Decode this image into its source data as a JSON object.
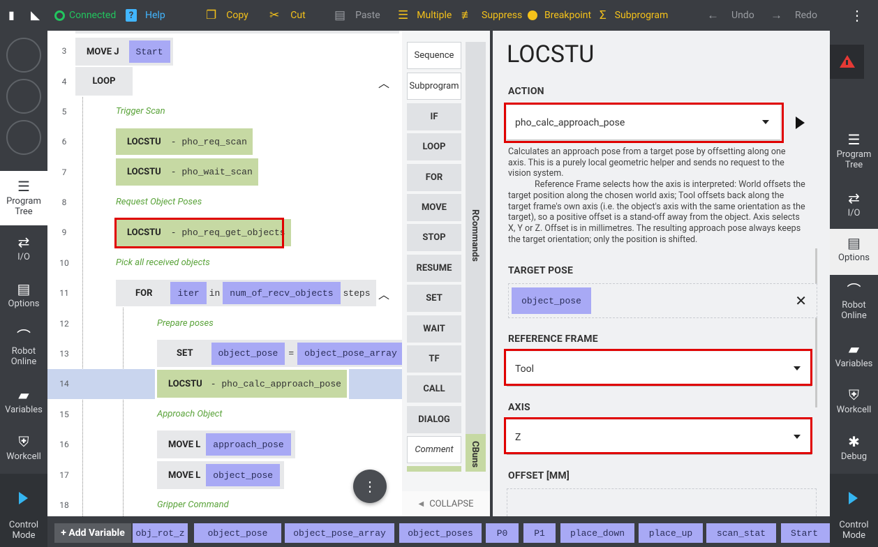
{
  "topbar": {
    "connected": "Connected",
    "help": "Help",
    "copy": "Copy",
    "cut": "Cut",
    "paste": "Paste",
    "multiple": "Multiple",
    "suppress": "Suppress",
    "breakpoint": "Breakpoint",
    "subprogram": "Subprogram",
    "undo": "Undo",
    "redo": "Redo"
  },
  "left_nav": {
    "items": [
      {
        "label": "Program Tree",
        "icon": "program-tree-icon"
      },
      {
        "label": "I/O",
        "icon": "io-icon"
      },
      {
        "label": "Options",
        "icon": "clipboard-icon"
      },
      {
        "label": "Robot Online",
        "icon": "robot-arm-icon"
      },
      {
        "label": "Variables",
        "icon": "briefcase-icon"
      },
      {
        "label": "Workcell",
        "icon": "shield-icon"
      }
    ],
    "control_mode": "Control Mode"
  },
  "right_nav": {
    "items": [
      {
        "label": "Program Tree",
        "icon": "program-tree-icon"
      },
      {
        "label": "I/O",
        "icon": "io-icon"
      },
      {
        "label": "Options",
        "icon": "clipboard-icon"
      },
      {
        "label": "Robot Online",
        "icon": "robot-arm-icon"
      },
      {
        "label": "Variables",
        "icon": "briefcase-icon"
      },
      {
        "label": "Workcell",
        "icon": "shield-icon"
      },
      {
        "label": "Debug",
        "icon": "bug-icon"
      }
    ],
    "control_mode": "Control Mode"
  },
  "program": {
    "lines": [
      {
        "n": "3",
        "cmd": "MOVE J",
        "var": "Start"
      },
      {
        "n": "4",
        "cmd": "LOOP"
      },
      {
        "n": "5",
        "comment": "Trigger Scan"
      },
      {
        "n": "6",
        "cmd": "LOCSTU",
        "arg": "- pho_req_scan"
      },
      {
        "n": "7",
        "cmd": "LOCSTU",
        "arg": "- pho_wait_scan"
      },
      {
        "n": "8",
        "comment": "Request Object Poses"
      },
      {
        "n": "9",
        "cmd": "LOCSTU",
        "arg": "- pho_req_get_objects"
      },
      {
        "n": "10",
        "comment": "Pick all received objects"
      },
      {
        "n": "11",
        "cmd": "FOR",
        "var1": "iter",
        "in": "in",
        "var2": "num_of_recv_objects",
        "steps": "steps"
      },
      {
        "n": "12",
        "comment": "Prepare poses"
      },
      {
        "n": "13",
        "cmd": "SET",
        "var1": "object_pose",
        "eq": "=",
        "var2": "object_pose_array",
        "tail": "["
      },
      {
        "n": "14",
        "cmd": "LOCSTU",
        "arg": "- pho_calc_approach_pose"
      },
      {
        "n": "15",
        "comment": "Approach Object"
      },
      {
        "n": "16",
        "cmd": "MOVE L",
        "var": "approach_pose"
      },
      {
        "n": "17",
        "cmd": "MOVE L",
        "var": "object_pose"
      },
      {
        "n": "18",
        "comment": "Gripper Command"
      }
    ]
  },
  "palette": {
    "buttons": [
      "Sequence",
      "Subprogram",
      "IF",
      "LOOP",
      "FOR",
      "MOVE",
      "STOP",
      "RESUME",
      "SET",
      "WAIT",
      "TF",
      "CALL",
      "DIALOG",
      "Comment"
    ],
    "tab_rcommands": "RCommands",
    "tab_cbuns": "CBuns",
    "collapse": "COLLAPSE"
  },
  "options": {
    "title": "LOCSTU",
    "action_label": "ACTION",
    "action_value": "pho_calc_approach_pose",
    "description_p1": "Calculates an approach pose from a target pose by offsetting along one axis. This is a purely local geometric helper and sends no request to the vision system.",
    "description_p2": "Reference Frame selects how the axis is interpreted: World offsets the target position along the chosen world axis; Tool offsets back along the target frame's own axis (i.e. the object's axis with the same orientation as the target), so a positive offset is a stand-off away from the object. Axis selects X, Y or Z. Offset is in millimetres. The resulting approach pose always keeps the target orientation; only the position is shifted.",
    "target_pose_label": "TARGET POSE",
    "target_pose_value": "object_pose",
    "reference_frame_label": "REFERENCE FRAME",
    "reference_frame_value": "Tool",
    "axis_label": "AXIS",
    "axis_value": "Z",
    "offset_label": "OFFSET [MM]"
  },
  "varbar": {
    "add_label": "+ Add Variable",
    "vars": [
      "obj_rot_z",
      "object_pose",
      "object_pose_array",
      "object_poses",
      "P0",
      "P1",
      "place_down",
      "place_up",
      "scan_stat",
      "Start"
    ]
  },
  "colors": {
    "rail": "#3a3d42",
    "accent_yellow": "#f5c21a",
    "connected_green": "#22c55e",
    "variable_purple": "#a8a9f5",
    "block_green": "#c6d9a3",
    "highlight_red": "#e00000",
    "selected_row": "#c9d5ee"
  }
}
